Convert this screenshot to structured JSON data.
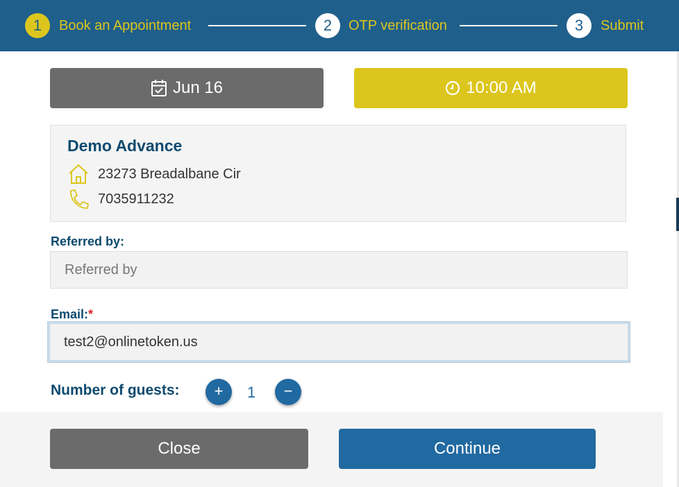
{
  "stepper": {
    "steps": [
      {
        "number": "1",
        "label": "Book an Appointment",
        "active": true
      },
      {
        "number": "2",
        "label": "OTP verification",
        "active": false
      },
      {
        "number": "3",
        "label": "Submit",
        "active": false
      }
    ]
  },
  "appointment": {
    "date_label": "Jun 16",
    "time_label": "10:00 AM"
  },
  "location": {
    "name": "Demo Advance",
    "address": "23273 Breadalbane Cir",
    "phone": "7035911232"
  },
  "form": {
    "referred_by": {
      "label": "Referred by:",
      "placeholder": "Referred by",
      "value": ""
    },
    "email": {
      "label": "Email:",
      "required_mark": "*",
      "value": "test2@onlinetoken.us"
    },
    "guests": {
      "label": "Number of guests:",
      "count": "1",
      "increment_symbol": "+",
      "decrement_symbol": "−"
    }
  },
  "footer": {
    "close_label": "Close",
    "continue_label": "Continue"
  },
  "colors": {
    "header_bg": "#1f5f8b",
    "accent_yellow": "#dcc61d",
    "primary_blue": "#2169a1",
    "gray_button": "#6b6b6b",
    "heading_navy": "#0e4a6e"
  },
  "icons": {
    "date": "calendar-check-icon",
    "time": "clock-icon",
    "address": "home-icon",
    "phone": "phone-icon"
  }
}
